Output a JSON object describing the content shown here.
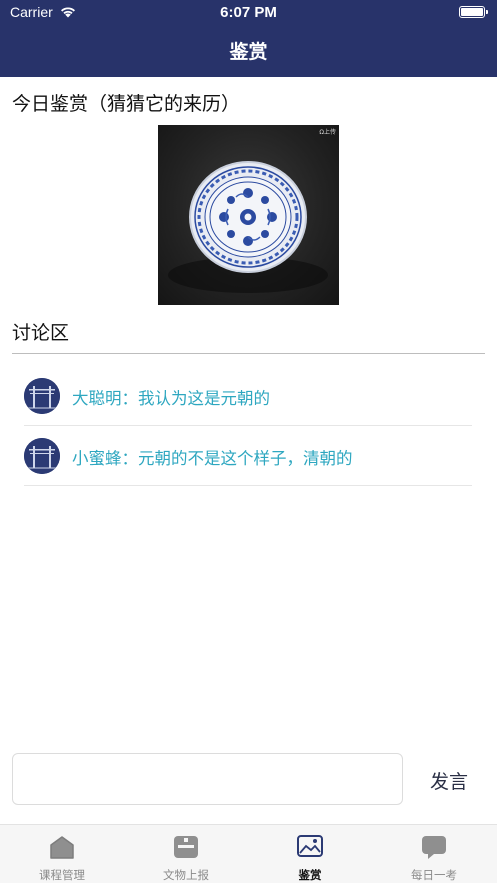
{
  "status_bar": {
    "carrier": "Carrier",
    "time": "6:07 PM"
  },
  "nav": {
    "title": "鉴赏"
  },
  "today": {
    "title": "今日鉴赏（猜猜它的来历）",
    "image_mark": "Ω上传"
  },
  "discussion": {
    "title": "讨论区",
    "comments": [
      {
        "text": "大聪明：我认为这是元朝的"
      },
      {
        "text": "小蜜蜂：元朝的不是这个样子，清朝的"
      }
    ]
  },
  "composer": {
    "input_value": "",
    "send_label": "发言"
  },
  "tabbar": {
    "tabs": [
      {
        "label": "课程管理",
        "icon": "course-icon"
      },
      {
        "label": "文物上报",
        "icon": "report-icon"
      },
      {
        "label": "鉴赏",
        "icon": "appreciation-icon"
      },
      {
        "label": "每日一考",
        "icon": "quiz-icon"
      }
    ],
    "active_index": 2
  },
  "colors": {
    "nav_bg": "#28336a",
    "comment_text": "#2ea7c0",
    "tab_inactive": "#8a8a8a"
  }
}
